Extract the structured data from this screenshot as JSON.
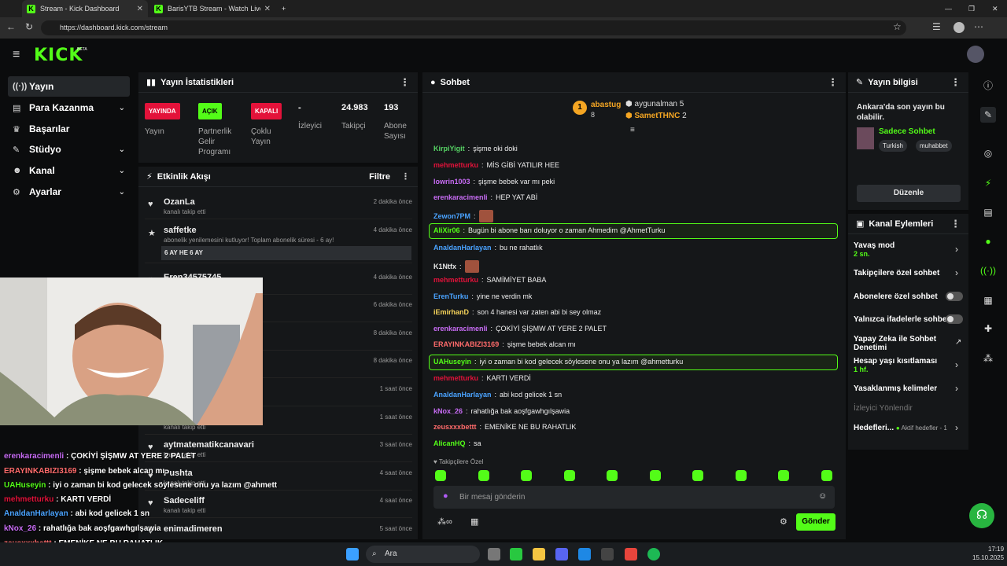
{
  "browser": {
    "tab1": "Stream - Kick Dashboard",
    "tab2": "BarisYTB Stream - Watch Live on Kick",
    "url": "https://dashboard.kick.com/stream"
  },
  "brand": {
    "logo": "KICK",
    "beta": "BETA",
    "accent": "#53fc18"
  },
  "sidebar": {
    "items": [
      {
        "label": "Yayın",
        "icon": "broadcast-icon"
      },
      {
        "label": "Para Kazanma",
        "icon": "money-icon"
      },
      {
        "label": "Başarılar",
        "icon": "trophy-icon"
      },
      {
        "label": "Stüdyo",
        "icon": "studio-icon"
      },
      {
        "label": "Kanal",
        "icon": "person-icon"
      },
      {
        "label": "Ayarlar",
        "icon": "gear-icon"
      }
    ]
  },
  "stats": {
    "title": "Yayın İstatistikleri",
    "items": [
      {
        "badge": "YAYINDA",
        "label": "Yayın"
      },
      {
        "badge": "AÇIK",
        "label": "Partnerlik Gelir Programı"
      },
      {
        "badge": "KAPALI",
        "label": "Çoklu Yayın"
      },
      {
        "value": "-",
        "label": "İzleyici"
      },
      {
        "value": "24.983",
        "label": "Takipçi"
      },
      {
        "value": "193",
        "label": "Abone Sayısı"
      }
    ]
  },
  "activity": {
    "title": "Etkinlik Akışı",
    "filter": "Filtre",
    "items": [
      {
        "name": "OzanLa",
        "sub": "kanalı takip etti",
        "time": "2 dakika önce"
      },
      {
        "name": "saffetke",
        "sub": "abonelik yenilemesini kutluyor! Toplam abonelik süresi - 6 ay!",
        "note": "6 AY HE 6 AY",
        "time": "4 dakika önce"
      },
      {
        "name": "Eren34575745",
        "sub": "",
        "time": "4 dakika önce"
      },
      {
        "name": "",
        "sub": "",
        "time": "6 dakika önce"
      },
      {
        "name": "",
        "sub": "",
        "time": "8 dakika önce"
      },
      {
        "name": "",
        "sub": "",
        "time": "8 dakika önce"
      },
      {
        "name": "",
        "sub": "",
        "time": "1 saat önce"
      },
      {
        "name": "",
        "sub": "kanalı takip etti",
        "time": "1 saat önce"
      },
      {
        "name": "aytmatematikcanavari",
        "sub": "kanalı takip etti",
        "time": "3 saat önce"
      },
      {
        "name": "Pushta",
        "sub": "kanalı takip etti",
        "time": "4 saat önce"
      },
      {
        "name": "Sadeceliff",
        "sub": "kanalı takip etti",
        "time": "4 saat önce"
      },
      {
        "name": "enimadimeren",
        "sub": "",
        "time": "5 saat önce"
      }
    ]
  },
  "chat": {
    "title": "Sohbet",
    "top": [
      {
        "name": "abastug",
        "count": "8"
      },
      {
        "name": "aygunalman",
        "count": "5"
      },
      {
        "name": "SametTHNC",
        "count": "2"
      }
    ],
    "messages": [
      {
        "user": "KirpiYigit",
        "color": "#56d364",
        "text": "şişme oki doki"
      },
      {
        "user": "mehmetturku",
        "color": "#e3123a",
        "text": "MİS GİBİ YATILIR HEE"
      },
      {
        "user": "lowrin1003",
        "color": "#c86cf5",
        "text": "şişme bebek var mı peki"
      },
      {
        "user": "erenkaracimenli",
        "color": "#c86cf5",
        "text": "HEP YAT ABİ"
      },
      {
        "user": "Zewon7PM",
        "color": "#4aa3ff",
        "text": ""
      },
      {
        "user": "AliXir06",
        "color": "#53fc18",
        "text": "Bugün bi abone barı doluyor o zaman Ahmedim @AhmetTurku"
      },
      {
        "user": "AnaldanHarlayan",
        "color": "#4aa3ff",
        "text": "bu ne rahatlık"
      },
      {
        "user": "K1Ntfx",
        "color": "#e8e8e8",
        "text": ""
      },
      {
        "user": "mehmetturku",
        "color": "#e3123a",
        "text": "SAMİMİYET BABA"
      },
      {
        "user": "ErenTurku",
        "color": "#4aa3ff",
        "text": "yine ne verdin mk"
      },
      {
        "user": "iEmirhanD",
        "color": "#f5d25a",
        "text": "son 4 hanesi var zaten abi bi sey olmaz"
      },
      {
        "user": "erenkaracimenli",
        "color": "#c86cf5",
        "text": "ÇOKİYİ ŞİŞMW AT YERE 2 PALET"
      },
      {
        "user": "ERAYINKABIZI3169",
        "color": "#ff6b6b",
        "text": "şişme bebek alcan mı"
      },
      {
        "user": "UAHuseyin",
        "color": "#53fc18",
        "text": "iyi o zaman bi kod gelecek söylesene onu ya lazım @ahmetturku"
      },
      {
        "user": "mehmetturku",
        "color": "#e3123a",
        "text": "KARTI VERDİ"
      },
      {
        "user": "AnaldanHarlayan",
        "color": "#4aa3ff",
        "text": "abi kod gelicek 1 sn"
      },
      {
        "user": "kNox_26",
        "color": "#c86cf5",
        "text": "rahatlığa bak aoşfgawhgılşawia"
      },
      {
        "user": "zeusxxxbettt",
        "color": "#ff6b6b",
        "text": "EMENİKE NE BU RAHATLIK"
      },
      {
        "user": "AlicanHQ",
        "color": "#53fc18",
        "text": "sa"
      }
    ],
    "followers_only": "Takipçilere Özel",
    "placeholder": "Bir mesaj gönderin",
    "send": "Gönder"
  },
  "info": {
    "title": "Yayın bilgisi",
    "stream_title": "Ankara'da son yayın bu olabilir.",
    "category": "Sadece Sohbet",
    "tags": [
      "Turkish",
      "muhabbet"
    ],
    "edit": "Düzenle"
  },
  "actions": {
    "title": "Kanal Eylemleri",
    "items": [
      {
        "label": "Yavaş mod",
        "sub": "2 sn."
      },
      {
        "label": "Takipçilere özel sohbet",
        "sub": ""
      },
      {
        "label": "Abonelere özel sohbet",
        "sub": ""
      },
      {
        "label": "Yalnızca ifadelerle sohbet",
        "sub": ""
      },
      {
        "label": "Yapay Zeka ile Sohbet Denetimi",
        "sub": ""
      },
      {
        "label": "Hesap yaşı kısıtlaması",
        "sub": "1 hf."
      },
      {
        "label": "Yasaklanmış kelimeler",
        "sub": ""
      },
      {
        "label": "İzleyici Yönlendir",
        "sub": ""
      },
      {
        "label": "Hedefleri...",
        "sub": "Aktif hedefler - 1"
      }
    ]
  },
  "overlay": [
    {
      "user": "erenkaracimenli",
      "text": "ÇOKİYİ ŞİŞMW AT YERE 2 PALET",
      "color": "#c86cf5"
    },
    {
      "user": "ERAYINKABIZI3169",
      "text": "şişme bebek alcan mı",
      "color": "#ff6b6b"
    },
    {
      "user": "UAHuseyin",
      "text": "iyi o zaman bi kod gelecek söylesene onu ya lazım @ahmett",
      "color": "#53fc18"
    },
    {
      "user": "mehmetturku",
      "text": "KARTI VERDİ",
      "color": "#e3123a"
    },
    {
      "user": "AnaldanHarlayan",
      "text": "abi kod gelicek 1 sn",
      "color": "#4aa3ff"
    },
    {
      "user": "kNox_26",
      "text": "rahatlığa bak aoşfgawhgılşawia",
      "color": "#c86cf5"
    },
    {
      "user": "zeusxxxbettt",
      "text": "EMENİKE NE BU RAHATLIK",
      "color": "#ff6b6b"
    },
    {
      "user": "AlicanHQ",
      "text": "sa",
      "color": "#53fc18"
    }
  ],
  "taskbar": {
    "search": "Ara",
    "time": "17:19",
    "date": "15.10.2025"
  }
}
